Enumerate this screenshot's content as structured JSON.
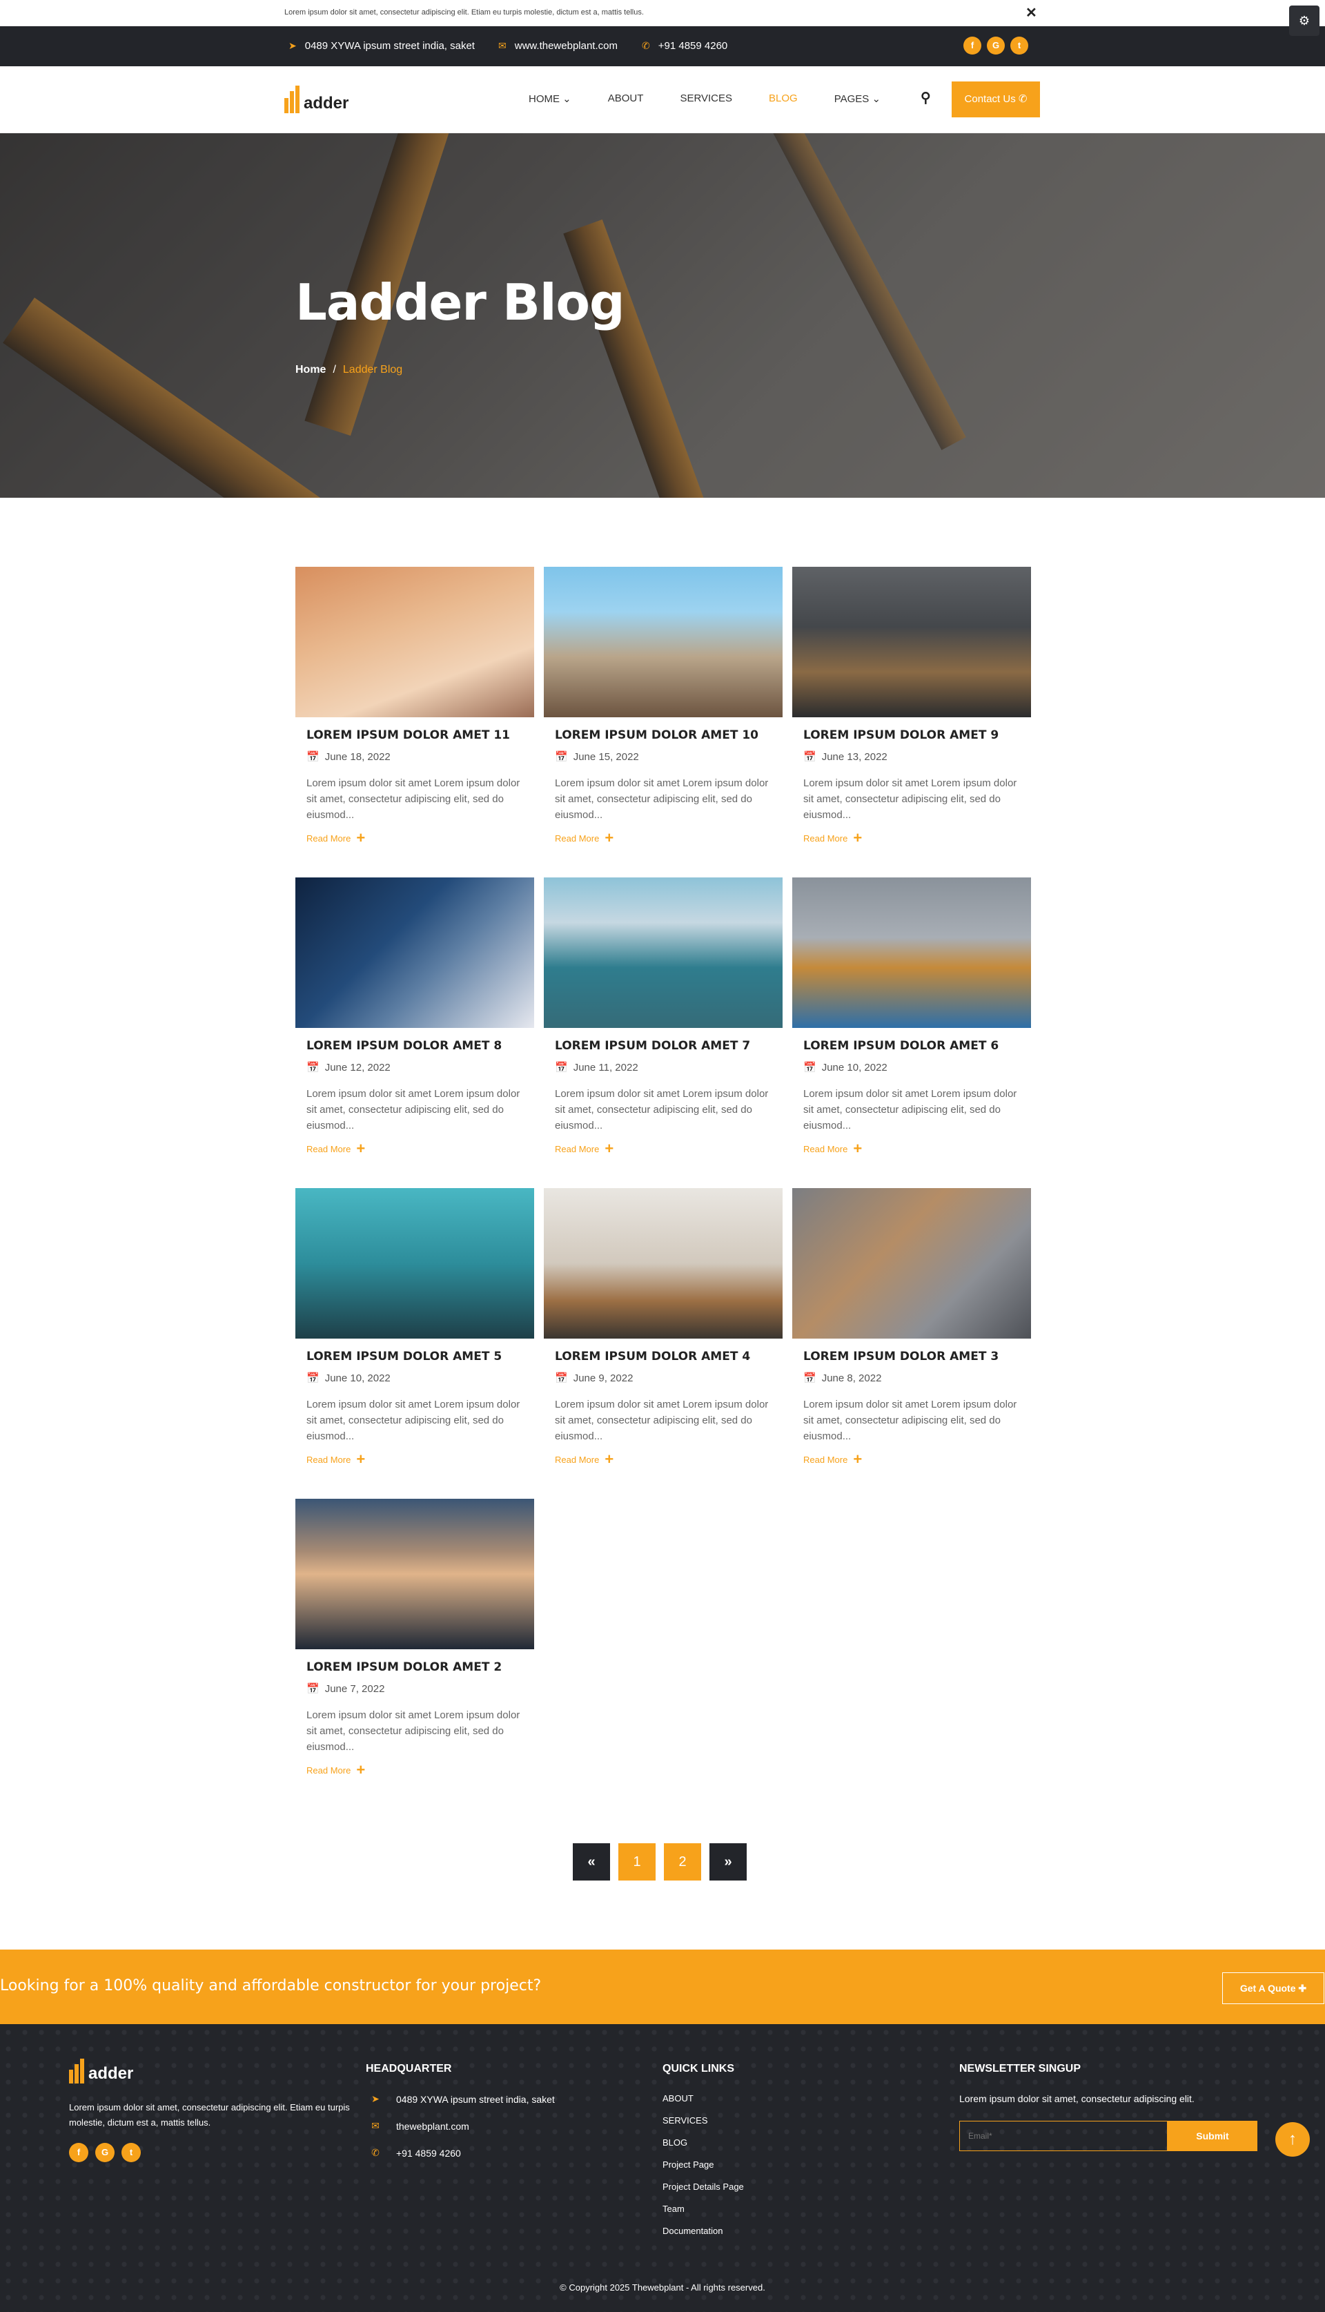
{
  "notice": {
    "text": "Lorem ipsum dolor sit amet, consectetur adipiscing elit. Etiam eu turpis molestie, dictum est a, mattis tellus.",
    "close": "✕"
  },
  "topbar": {
    "address": "0489 XYWA ipsum street india, saket",
    "website": "www.thewebplant.com",
    "phone": "+91 4859 4260",
    "social": [
      "f",
      "G",
      "t"
    ]
  },
  "brand": {
    "name": "adder"
  },
  "nav": {
    "items": [
      "HOME ⌄",
      "ABOUT",
      "SERVICES",
      "BLOG",
      "PAGES ⌄"
    ],
    "active_index": 3,
    "contact_label": "Contact Us ✆"
  },
  "hero": {
    "title": "Ladder Blog",
    "crumb_home": "Home",
    "crumb_sep": "/",
    "crumb_current": "Ladder Blog"
  },
  "posts": [
    {
      "title": "LOREM IPSUM DOLOR AMET 11",
      "date": "June 18, 2022",
      "excerpt": "Lorem ipsum dolor sit amet Lorem ipsum dolor sit amet, consectetur adipiscing elit, sed do eiusmod...",
      "read_more": "Read More"
    },
    {
      "title": "LOREM IPSUM DOLOR AMET 10",
      "date": "June 15, 2022",
      "excerpt": "Lorem ipsum dolor sit amet Lorem ipsum dolor sit amet, consectetur adipiscing elit, sed do eiusmod...",
      "read_more": "Read More"
    },
    {
      "title": "LOREM IPSUM DOLOR AMET 9",
      "date": "June 13, 2022",
      "excerpt": "Lorem ipsum dolor sit amet Lorem ipsum dolor sit amet, consectetur adipiscing elit, sed do eiusmod...",
      "read_more": "Read More"
    },
    {
      "title": "LOREM IPSUM DOLOR AMET 8",
      "date": "June 12, 2022",
      "excerpt": "Lorem ipsum dolor sit amet Lorem ipsum dolor sit amet, consectetur adipiscing elit, sed do eiusmod...",
      "read_more": "Read More"
    },
    {
      "title": "LOREM IPSUM DOLOR AMET 7",
      "date": "June 11, 2022",
      "excerpt": "Lorem ipsum dolor sit amet Lorem ipsum dolor sit amet, consectetur adipiscing elit, sed do eiusmod...",
      "read_more": "Read More"
    },
    {
      "title": "LOREM IPSUM DOLOR AMET 6",
      "date": "June 10, 2022",
      "excerpt": "Lorem ipsum dolor sit amet Lorem ipsum dolor sit amet, consectetur adipiscing elit, sed do eiusmod...",
      "read_more": "Read More"
    },
    {
      "title": "LOREM IPSUM DOLOR AMET 5",
      "date": "June 10, 2022",
      "excerpt": "Lorem ipsum dolor sit amet Lorem ipsum dolor sit amet, consectetur adipiscing elit, sed do eiusmod...",
      "read_more": "Read More"
    },
    {
      "title": "LOREM IPSUM DOLOR AMET 4",
      "date": "June 9, 2022",
      "excerpt": "Lorem ipsum dolor sit amet Lorem ipsum dolor sit amet, consectetur adipiscing elit, sed do eiusmod...",
      "read_more": "Read More"
    },
    {
      "title": "LOREM IPSUM DOLOR AMET 3",
      "date": "June 8, 2022",
      "excerpt": "Lorem ipsum dolor sit amet Lorem ipsum dolor sit amet, consectetur adipiscing elit, sed do eiusmod...",
      "read_more": "Read More"
    },
    {
      "title": "LOREM IPSUM DOLOR AMET 2",
      "date": "June 7, 2022",
      "excerpt": "Lorem ipsum dolor sit amet Lorem ipsum dolor sit amet, consectetur adipiscing elit, sed do eiusmod...",
      "read_more": "Read More"
    }
  ],
  "pagination": {
    "prev": "«",
    "pages": [
      "1",
      "2"
    ],
    "next": "»"
  },
  "cta": {
    "text": "Looking for a 100% quality and affordable constructor for your project?",
    "button": "Get A Quote ✚"
  },
  "footer": {
    "about": "Lorem ipsum dolor sit amet, consectetur adipiscing elit. Etiam eu turpis molestie, dictum est a, mattis tellus.",
    "hq_heading": "HEADQUARTER",
    "hq_address": "0489 XYWA ipsum street india, saket",
    "hq_website": "thewebplant.com",
    "hq_phone": "+91 4859 4260",
    "links_heading": "QUICK LINKS",
    "links": [
      "ABOUT",
      "SERVICES",
      "BLOG",
      "Project Page",
      "Project Details Page",
      "Team",
      "Documentation"
    ],
    "newsletter_heading": "NEWSLETTER SINGUP",
    "newsletter_text": "Lorem ipsum dolor sit amet, consectetur adipiscing elit.",
    "email_placeholder": "Email*",
    "submit": "Submit",
    "copyright": "© Copyright 2025 Thewebplant - All rights reserved."
  },
  "colors": {
    "accent": "#f7a21b",
    "dark": "#23252a"
  }
}
